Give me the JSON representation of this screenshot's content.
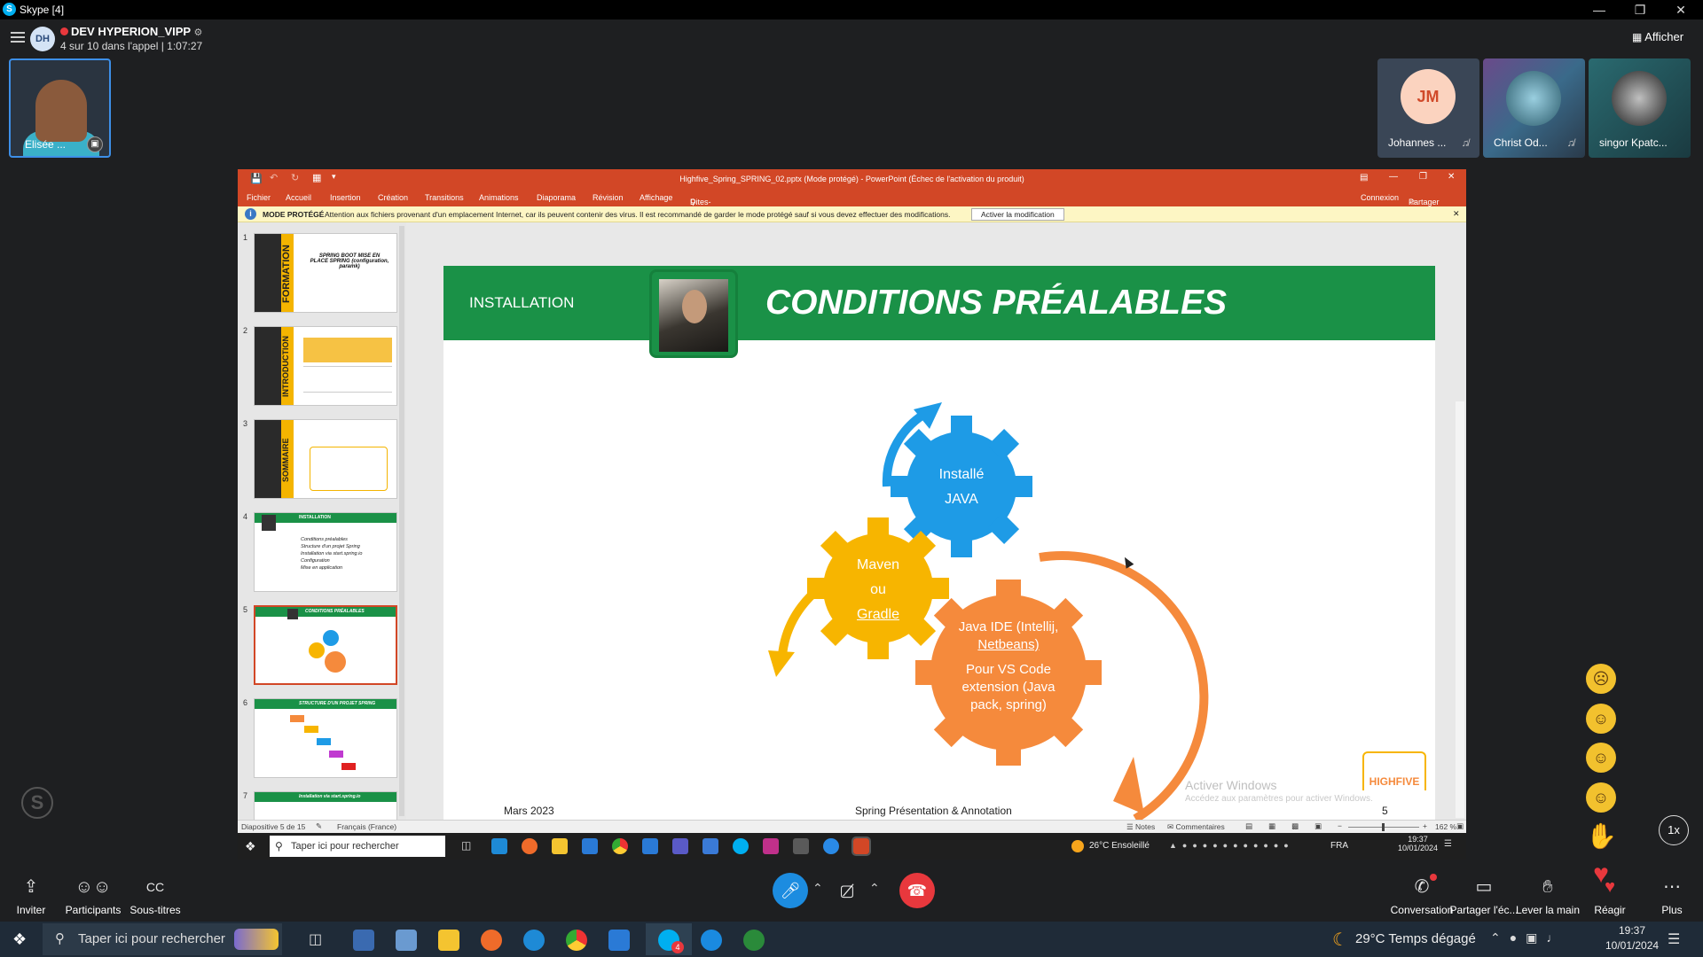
{
  "window": {
    "title": "Skype [4]"
  },
  "call": {
    "group_name": "DEV HYPERION_VIPP",
    "avatar_initials": "DH",
    "status": "4 sur 10 dans l'appel | 1:07:27",
    "show_label": "Afficher"
  },
  "self_tile": {
    "name": "Elisée ..."
  },
  "participants": [
    {
      "name": "Johannes ...",
      "initials": "JM"
    },
    {
      "name": "Christ Od..."
    },
    {
      "name": "singor Kpatc..."
    }
  ],
  "ppt": {
    "title": "Highfive_Spring_SPRING_02.pptx (Mode protégé) - PowerPoint (Échec de l'activation du produit)",
    "ribbon_tabs": [
      "Fichier",
      "Accueil",
      "Insertion",
      "Création",
      "Transitions",
      "Animations",
      "Diaporama",
      "Révision",
      "Affichage"
    ],
    "tell_me": "Dites-nous ce que vous voulez faire...",
    "connexion": "Connexion",
    "partager": "Partager",
    "protected_label": "MODE PROTÉGÉ",
    "protected_msg": "Attention aux fichiers provenant d'un emplacement Internet, car ils peuvent contenir des virus. Il est recommandé de garder le mode protégé sauf si vous devez effectuer des modifications.",
    "protected_button": "Activer la modification",
    "thumbnails": [
      {
        "num": "1",
        "label": "FORMATION",
        "title": "SPRING BOOT MISE EN PLACE SPRING (configuration, paramk)"
      },
      {
        "num": "2",
        "label": "INTRODUCTION"
      },
      {
        "num": "3",
        "label": "SOMMAIRE"
      },
      {
        "num": "4",
        "header": "INSTALLATION",
        "items": [
          "Conditions préalables",
          "Structure d'un projet Spring",
          "Installation via start.spring.io",
          "Configuration",
          "Mise en application"
        ]
      },
      {
        "num": "5",
        "header": "CONDITIONS PRÉALABLES"
      },
      {
        "num": "6",
        "header": "STRUCTURE D'UN PROJET SPRING"
      },
      {
        "num": "7",
        "header": "Installation via start.spring.io"
      }
    ],
    "slide": {
      "section": "INSTALLATION",
      "title": "CONDITIONS PRÉALABLES",
      "gear_java": [
        "Installé",
        "JAVA"
      ],
      "gear_maven": [
        "Maven",
        "ou",
        "Gradle"
      ],
      "gear_ide": [
        "Java IDE (Intellij,",
        "Netbeans)",
        "Pour VS Code",
        "extension (Java",
        "pack, spring)"
      ],
      "footer_date": "Mars 2023",
      "footer_center": "Spring Présentation & Annotation",
      "footer_page": "5",
      "watermark_1": "Activer Windows",
      "watermark_2": "Accédez aux paramètres pour activer Windows.",
      "logo": "HIGHFIVE"
    },
    "status": {
      "slide_of": "Diapositive 5 de 15",
      "lang": "Français (France)",
      "notes": "Notes",
      "comments": "Commentaires",
      "zoom": "162 %"
    }
  },
  "inner_taskbar": {
    "search": "Taper ici pour rechercher",
    "weather": "26°C  Ensoleillé",
    "lang": "FRA",
    "time": "19:37",
    "date": "10/01/2024"
  },
  "controls": {
    "invite": "Inviter",
    "participants": "Participants",
    "subtitles": "Sous-titres",
    "conversation": "Conversation",
    "share": "Partager l'éc...",
    "raise_hand": "Lever la main",
    "react": "Réagir",
    "more": "Plus",
    "speed": "1x"
  },
  "os_taskbar": {
    "search": "Taper ici pour rechercher",
    "weather": "29°C  Temps dégagé",
    "time": "19:37",
    "date": "10/01/2024",
    "skype_badge": "4"
  },
  "colors": {
    "ppt_orange": "#d24726",
    "slide_green": "#1a9147",
    "gear_blue": "#1e9be6",
    "gear_yellow": "#f7b500",
    "gear_orange": "#f58a3c",
    "end_call_red": "#e8383d",
    "mic_blue": "#1c8ce0"
  }
}
